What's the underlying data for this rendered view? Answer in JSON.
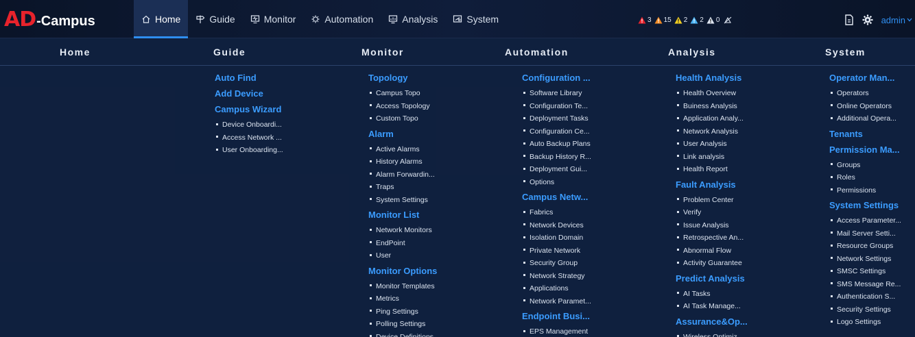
{
  "logo": {
    "brand": "AD",
    "product": "-Campus"
  },
  "nav": [
    {
      "label": "Home",
      "icon": "home-icon",
      "active": true
    },
    {
      "label": "Guide",
      "icon": "signpost-icon",
      "active": false
    },
    {
      "label": "Monitor",
      "icon": "monitor-icon",
      "active": false
    },
    {
      "label": "Automation",
      "icon": "automation-icon",
      "active": false
    },
    {
      "label": "Analysis",
      "icon": "analysis-icon",
      "active": false
    },
    {
      "label": "System",
      "icon": "system-icon",
      "active": false
    }
  ],
  "alarms": [
    {
      "count": "3",
      "color": "#e8232c",
      "icon": "critical-alarm-icon"
    },
    {
      "count": "15",
      "color": "#f08a24",
      "icon": "major-alarm-icon"
    },
    {
      "count": "2",
      "color": "#f5d020",
      "icon": "minor-alarm-icon"
    },
    {
      "count": "2",
      "color": "#4ab3f4",
      "icon": "warning-alarm-icon"
    },
    {
      "count": "0",
      "color": "#dfe6f2",
      "icon": "info-alarm-icon"
    }
  ],
  "user": {
    "name": "admin"
  },
  "menu": {
    "columns": [
      {
        "header": "Home",
        "groups": []
      },
      {
        "header": "Guide",
        "groups": [
          {
            "title": "Auto Find",
            "items": []
          },
          {
            "title": "Add Device",
            "items": []
          },
          {
            "title": "Campus Wizard",
            "items": [
              "Device Onboardi...",
              "Access Network ...",
              "User Onboarding..."
            ]
          }
        ]
      },
      {
        "header": "Monitor",
        "groups": [
          {
            "title": "Topology",
            "items": [
              "Campus Topo",
              "Access Topology",
              "Custom Topo"
            ]
          },
          {
            "title": "Alarm",
            "items": [
              "Active Alarms",
              "History Alarms",
              "Alarm Forwardin...",
              "Traps",
              "System Settings"
            ]
          },
          {
            "title": "Monitor List",
            "items": [
              "Network Monitors",
              "EndPoint",
              "User"
            ]
          },
          {
            "title": "Monitor Options",
            "items": [
              "Monitor Templates",
              "Metrics",
              "Ping Settings",
              "Polling Settings",
              "Device Definitions"
            ]
          }
        ]
      },
      {
        "header": "Automation",
        "groups": [
          {
            "title": "Configuration ...",
            "items": [
              "Software Library",
              "Configuration Te...",
              "Deployment Tasks",
              "Configuration Ce...",
              "Auto Backup Plans",
              "Backup History R...",
              "Deployment Gui...",
              "Options"
            ]
          },
          {
            "title": "Campus Netw...",
            "items": [
              "Fabrics",
              "Network Devices",
              "Isolation Domain",
              "Private Network",
              "Security Group",
              "Network Strategy",
              "Applications",
              "Network Paramet..."
            ]
          },
          {
            "title": "Endpoint Busi...",
            "items": [
              "EPS Management"
            ]
          }
        ]
      },
      {
        "header": "Analysis",
        "groups": [
          {
            "title": "Health Analysis",
            "items": [
              "Health Overview",
              "Buiness Analysis",
              "Application Analy...",
              "Network Analysis",
              "User Analysis",
              "Link analysis",
              "Health Report"
            ]
          },
          {
            "title": "Fault Analysis",
            "items": [
              "Problem Center",
              "Verify",
              "Issue Analysis",
              "Retrospective An...",
              "Abnormal Flow",
              "Activity Guarantee"
            ]
          },
          {
            "title": "Predict Analysis",
            "items": [
              "AI Tasks",
              "AI Task Manage..."
            ]
          },
          {
            "title": "Assurance&Op...",
            "items": [
              "Wireless Optimiz..."
            ]
          }
        ]
      },
      {
        "header": "System",
        "groups": [
          {
            "title": "Operator Man...",
            "items": [
              "Operators",
              "Online Operators",
              "Additional Opera..."
            ]
          },
          {
            "title": "Tenants",
            "items": []
          },
          {
            "title": "Permission Ma...",
            "items": [
              "Groups",
              "Roles",
              "Permissions"
            ]
          },
          {
            "title": "System Settings",
            "items": [
              "Access Parameter...",
              "Mail Server Setti...",
              "Resource Groups",
              "Network Settings",
              "SMSC Settings",
              "SMS Message Re...",
              "Authentication S...",
              "Security Settings",
              "Logo Settings"
            ]
          }
        ]
      }
    ]
  }
}
